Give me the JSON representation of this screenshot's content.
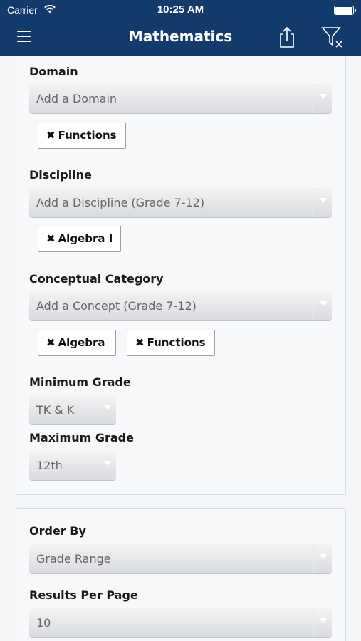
{
  "status_bar": {
    "carrier": "Carrier",
    "time": "10:25 AM"
  },
  "nav": {
    "title": "Mathematics",
    "menu_icon": "hamburger-icon",
    "share_icon": "share-icon",
    "filter_icon": "clear-filter-icon"
  },
  "filters": {
    "domain": {
      "label": "Domain",
      "placeholder": "Add a Domain",
      "chips": [
        "Functions"
      ]
    },
    "discipline": {
      "label": "Discipline",
      "placeholder": "Add a Discipline (Grade 7-12)",
      "chips": [
        "Algebra I"
      ]
    },
    "conceptual_category": {
      "label": "Conceptual Category",
      "placeholder": "Add a Concept (Grade 7-12)",
      "chips": [
        "Algebra",
        "Functions"
      ]
    },
    "minimum_grade": {
      "label": "Minimum Grade",
      "value": "TK & K"
    },
    "maximum_grade": {
      "label": "Maximum Grade",
      "value": "12th"
    }
  },
  "sorting": {
    "order_by": {
      "label": "Order By",
      "value": "Grade Range"
    },
    "results_per_page": {
      "label": "Results Per Page",
      "value": "10"
    }
  },
  "chip_remove_glyph": "✖",
  "colors": {
    "header": "#123b6b",
    "background": "#f4f5f7"
  }
}
